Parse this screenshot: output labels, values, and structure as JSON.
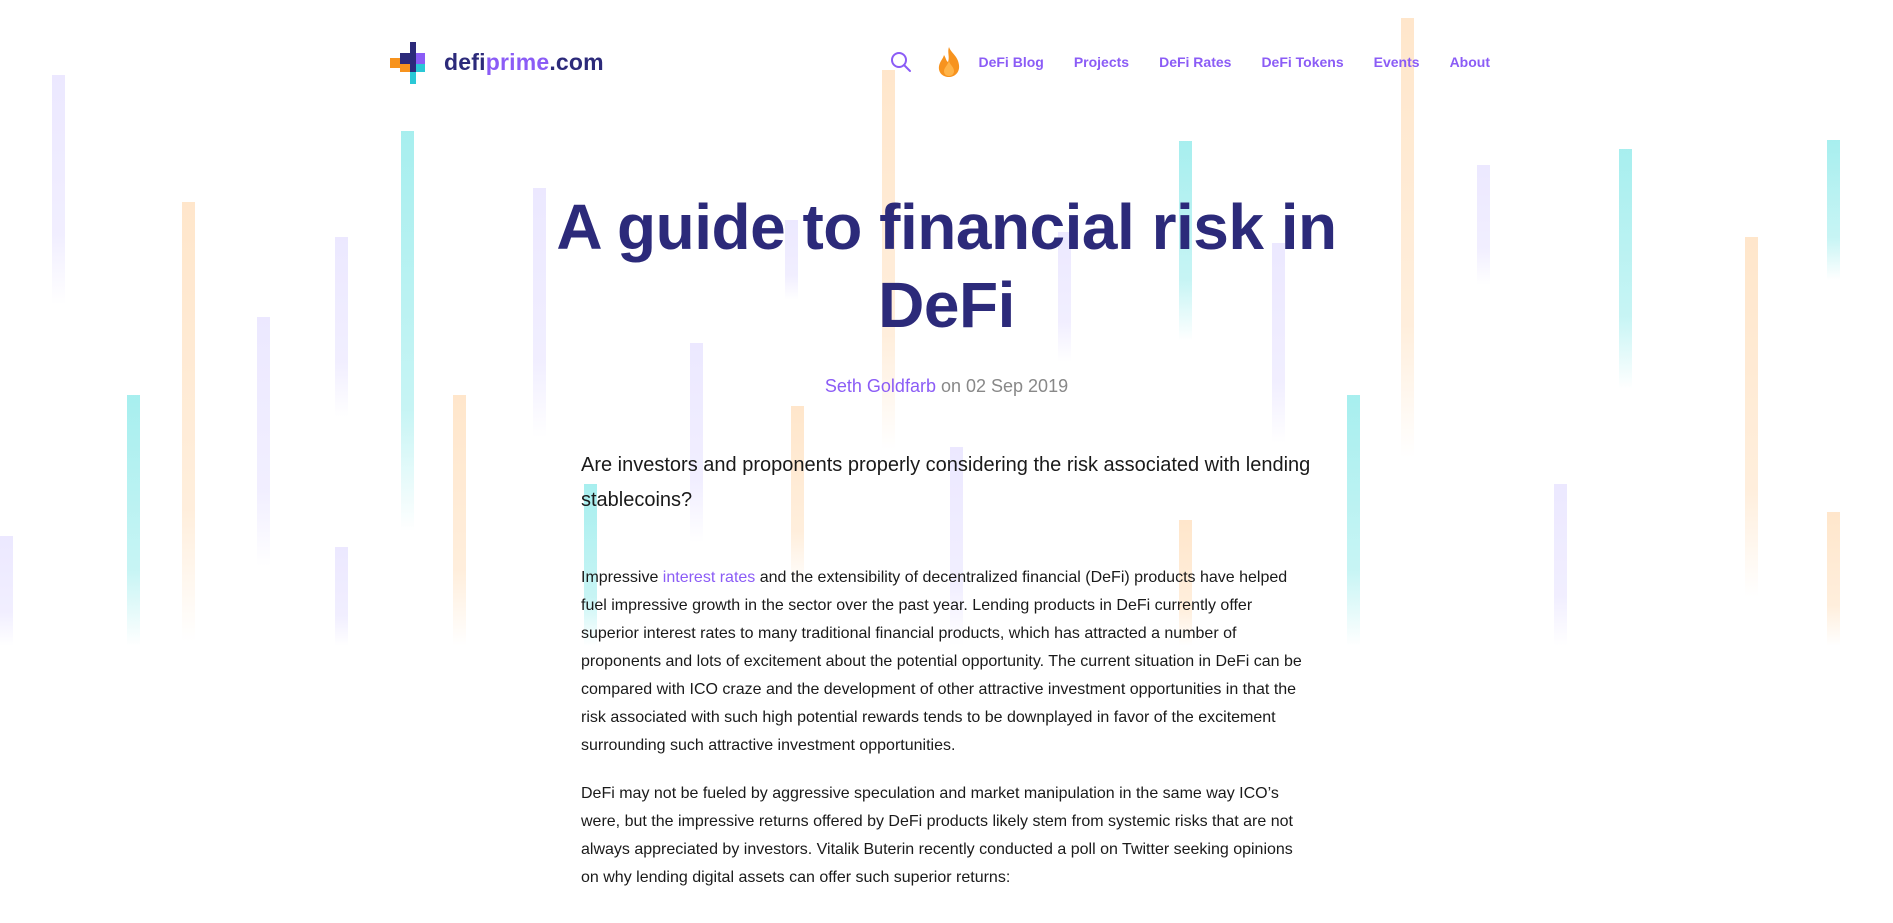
{
  "header": {
    "logo_text_prefix": "defi",
    "logo_text_accent": "prime",
    "logo_text_suffix": ".com",
    "nav": [
      {
        "label": "DeFi Blog"
      },
      {
        "label": "Projects"
      },
      {
        "label": "DeFi Rates"
      },
      {
        "label": "DeFi Tokens"
      },
      {
        "label": "Events"
      },
      {
        "label": "About"
      }
    ]
  },
  "article": {
    "title": "A guide to financial risk in DeFi",
    "author": "Seth Goldfarb",
    "date_text": " on 02 Sep 2019",
    "lede": "Are investors and proponents properly considering the risk associated with lending stablecoins?",
    "p1_before": "Impressive ",
    "p1_link": "interest rates",
    "p1_after": " and the extensibility of decentralized financial (DeFi) products have helped fuel impressive growth in the sector over the past year. Lending products in DeFi currently offer superior interest rates to many traditional financial products, which has attracted a number of proponents and lots of excitement about the potential opportunity. The current situation in DeFi can be compared with ICO craze and the development of other attractive investment opportunities in that the risk associated with such high potential rewards tends to be downplayed in favor of the excitement surrounding such attractive investment opportunities.",
    "p2": "DeFi may not be fueled by aggressive speculation and market manipulation in the same way ICO’s were, but the impressive returns offered by DeFi products likely stem from systemic risks that are not always appreciated by investors. Vitalik Buterin recently conducted a poll on Twitter seeking opinions on why lending digital assets can offer such superior returns:"
  },
  "colors": {
    "brand_dark": "#2c2a7a",
    "accent": "#8b5cf6",
    "fire": "#f7931e"
  },
  "icons": [
    "logo-mark-icon",
    "search-icon",
    "fire-icon"
  ]
}
